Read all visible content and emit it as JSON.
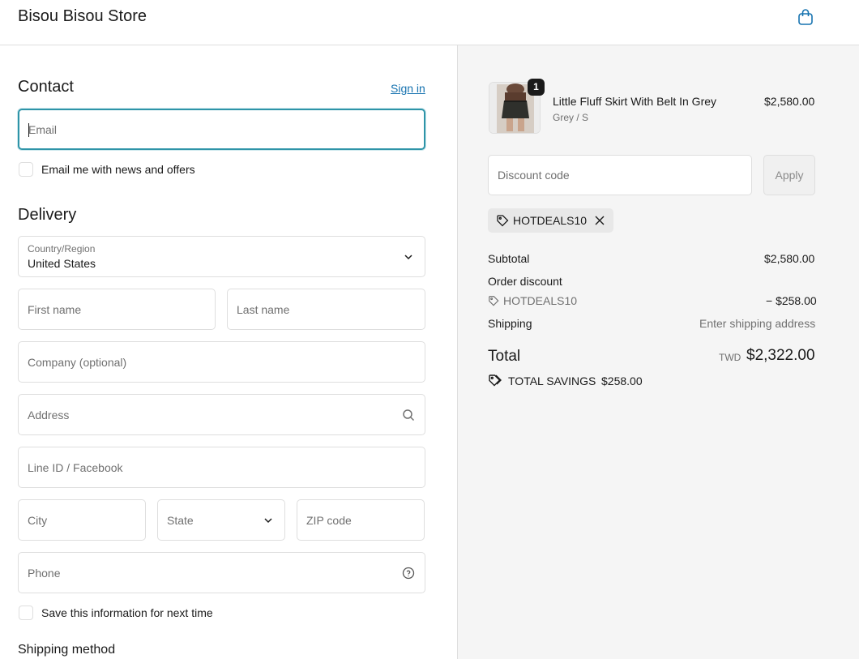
{
  "header": {
    "store_name": "Bisou Bisou Store",
    "bag_icon": "shopping-bag-icon"
  },
  "contact": {
    "title": "Contact",
    "sign_in": "Sign in",
    "email_placeholder": "Email",
    "news_label": "Email me with news and offers"
  },
  "delivery": {
    "title": "Delivery",
    "country_label": "Country/Region",
    "country_value": "United States",
    "first_name": "First name",
    "last_name": "Last name",
    "company": "Company (optional)",
    "address": "Address",
    "line_id": "Line ID / Facebook",
    "city": "City",
    "state": "State",
    "zip": "ZIP code",
    "phone": "Phone",
    "save_info": "Save this information for next time"
  },
  "shipping_method": {
    "title": "Shipping method"
  },
  "summary": {
    "item": {
      "qty": "1",
      "name": "Little Fluff Skirt With Belt In Grey",
      "variant": "Grey / S",
      "price": "$2,580.00"
    },
    "discount_placeholder": "Discount code",
    "apply": "Apply",
    "applied_code": "HOTDEALS10",
    "subtotal_label": "Subtotal",
    "subtotal_value": "$2,580.00",
    "order_discount_label": "Order discount",
    "discount_code": "HOTDEALS10",
    "discount_value": "− $258.00",
    "shipping_label": "Shipping",
    "shipping_value": "Enter shipping address",
    "total_label": "Total",
    "currency": "TWD",
    "total_value": "$2,322.00",
    "savings_label": "TOTAL SAVINGS",
    "savings_value": "$258.00"
  },
  "colors": {
    "accent": "#1773b0",
    "focus": "#2e94a8",
    "panel": "#f5f5f5",
    "border": "#dedede"
  }
}
